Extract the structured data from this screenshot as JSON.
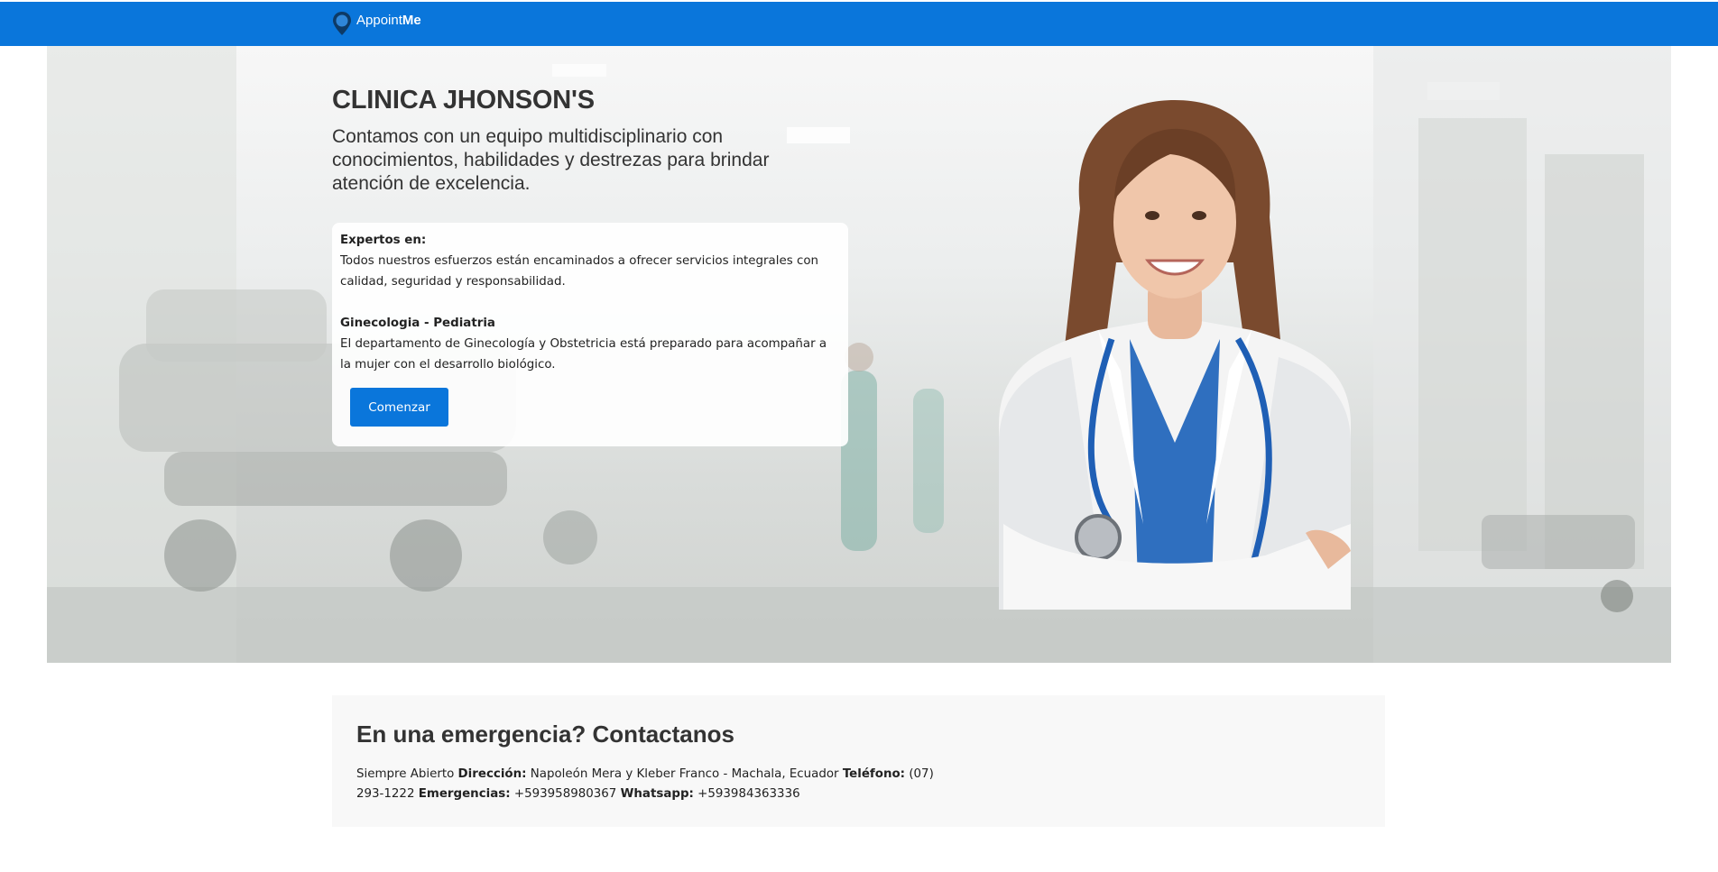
{
  "nav": {
    "brand_prefix": "Appoint",
    "brand_suffix": "Me",
    "accent": "#0a76db"
  },
  "hero": {
    "title": "CLINICA JHONSON'S",
    "subtitle": "Contamos con un equipo multidisciplinario con conocimientos, habilidades y destrezas para brindar atención de excelencia.",
    "card": {
      "heading1": "Expertos en:",
      "text1": "Todos nuestros esfuerzos están encaminados a ofrecer servicios integrales con calidad, seguridad y responsabilidad.",
      "heading2": "Ginecologia - Pediatria",
      "text2": "El departamento de Ginecología y Obstetricia está preparado para acompañar a la mujer con el desarrollo biológico.",
      "button_label": "Comenzar"
    },
    "image_icon": "doctor-photo"
  },
  "emergency": {
    "title": "En una emergencia? Contactanos",
    "open_text": "Siempre Abierto",
    "address_label": "Dirección:",
    "address": "Napoleón Mera y Kleber Franco - Machala, Ecuador",
    "phone_label": "Teléfono:",
    "phone": "(07) 293-1222",
    "emergency_label": "Emergencias:",
    "emergency_phone": "+593958980367",
    "whatsapp_label": "Whatsapp:",
    "whatsapp": "+593984363336"
  }
}
